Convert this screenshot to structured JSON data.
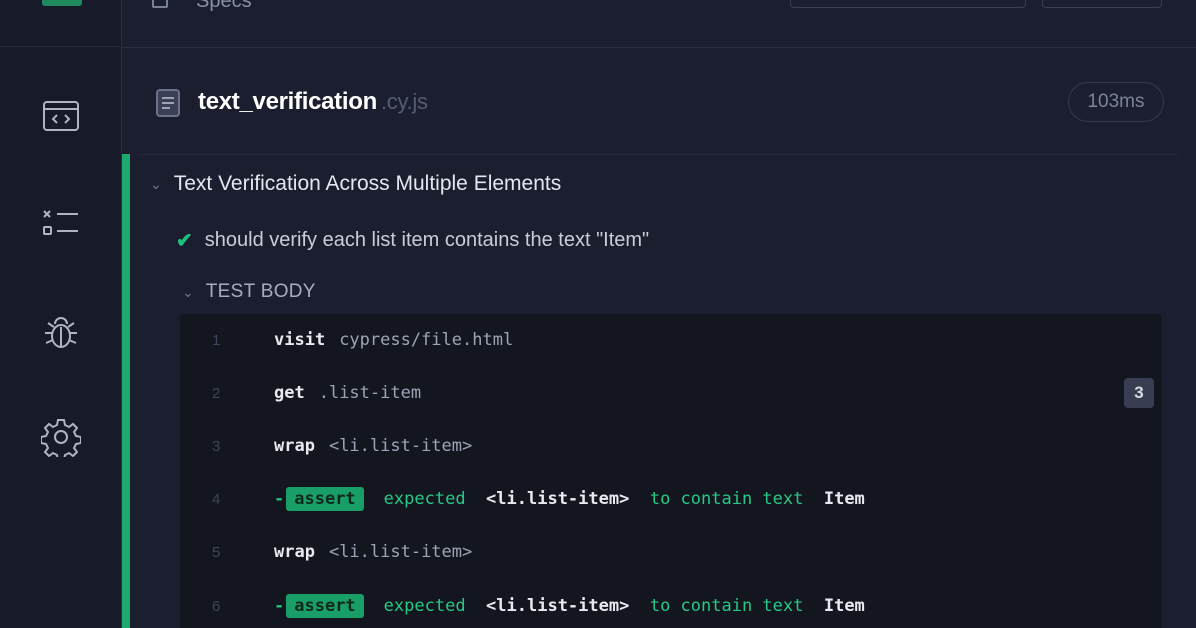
{
  "topbar": {
    "specs_label": "Specs"
  },
  "sidebar": {
    "items": [
      {
        "name": "specs",
        "icon": "code-window-icon"
      },
      {
        "name": "runs",
        "icon": "test-list-icon"
      },
      {
        "name": "debug",
        "icon": "bug-icon"
      },
      {
        "name": "settings",
        "icon": "gear-icon"
      }
    ]
  },
  "spec": {
    "name": "text_verification",
    "ext": ".cy.js",
    "duration": "103ms"
  },
  "suite": {
    "title": "Text Verification Across Multiple Elements"
  },
  "test": {
    "title": "should verify each list item contains the text \"Item\"",
    "status": "passed"
  },
  "test_body": {
    "label": "TEST BODY"
  },
  "commands": [
    {
      "num": "1",
      "name": "visit",
      "message": "cypress/file.html"
    },
    {
      "num": "2",
      "name": "get",
      "message": ".list-item",
      "count": "3"
    },
    {
      "num": "3",
      "name": "wrap",
      "message": "<li.list-item>"
    },
    {
      "num": "4",
      "name": "assert",
      "prefix": "-",
      "pre": "expected",
      "subject": "<li.list-item>",
      "mid": "to contain text",
      "value": "Item"
    },
    {
      "num": "5",
      "name": "wrap",
      "message": "<li.list-item>"
    },
    {
      "num": "6",
      "name": "assert",
      "prefix": "-",
      "pre": "expected",
      "subject": "<li.list-item>",
      "mid": "to contain text",
      "value": "Item"
    }
  ],
  "colors": {
    "pass": "#1fa971",
    "background": "#1b1e2e"
  }
}
